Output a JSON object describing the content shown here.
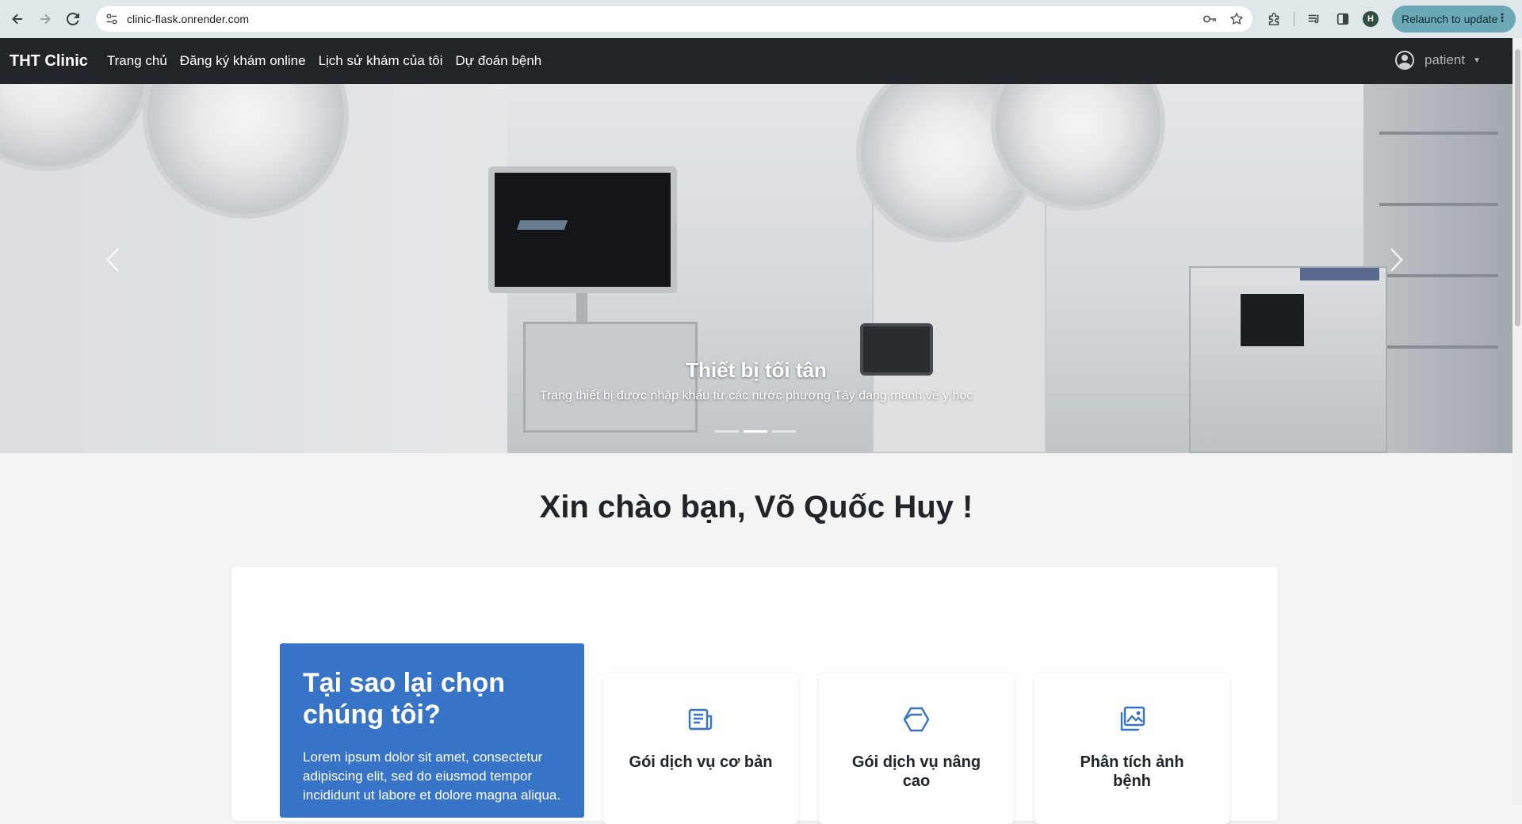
{
  "browser": {
    "url": "clinic-flask.onrender.com",
    "relaunch_label": "Relaunch to update",
    "profile_initial": "H"
  },
  "navbar": {
    "brand": "THT Clinic",
    "links": [
      {
        "label": "Trang chủ"
      },
      {
        "label": "Đăng ký khám online"
      },
      {
        "label": "Lịch sử khám của tôi"
      },
      {
        "label": "Dự đoán bệnh"
      }
    ],
    "user": "patient"
  },
  "carousel": {
    "caption_title": "Thiết bị tối tân",
    "caption_text": "Trang thiết bị được nhập khẩu từ các nước phương Tây đang mạnh về y học",
    "slide_count": 3,
    "active_slide": 2
  },
  "greeting": "Xin chào bạn, Võ Quốc Huy !",
  "why": {
    "title": "Tại sao lại chọn chúng tôi?",
    "text": "Lorem ipsum dolor sit amet, consectetur adipiscing elit, sed do eiusmod tempor incididunt ut labore et dolore magna aliqua."
  },
  "services": [
    {
      "title": "Gói dịch vụ cơ bản",
      "icon": "newspaper-icon"
    },
    {
      "title": "Gói dịch vụ nâng cao",
      "icon": "box-icon"
    },
    {
      "title": "Phân tích ảnh bệnh",
      "icon": "images-icon"
    }
  ],
  "colors": {
    "navbar_bg": "#212529",
    "accent_blue": "#3774c7",
    "relaunch_bg": "#6aa9b5"
  }
}
